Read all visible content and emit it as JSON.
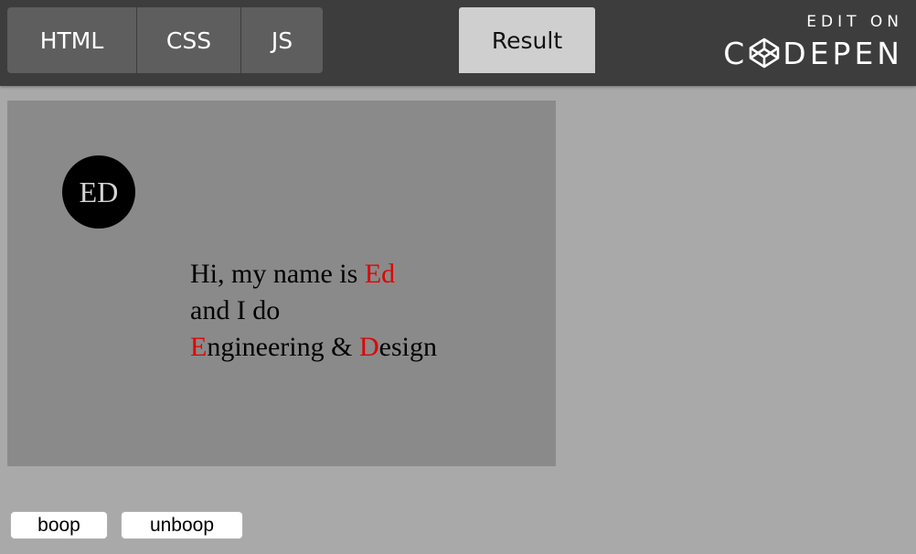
{
  "tabs": {
    "html": "HTML",
    "css": "CSS",
    "js": "JS",
    "result": "Result"
  },
  "codepen": {
    "edit_on": "EDIT ON",
    "brand_left": "C",
    "brand_right": "DEPEN",
    "icon": "codepen-logo-icon"
  },
  "card": {
    "avatar_initials": "ED",
    "line1_prefix": "Hi, my name is ",
    "line1_name": "Ed",
    "line2": "and I do",
    "line3_e": "E",
    "line3_mid": "ngineering & ",
    "line3_d": "D",
    "line3_end": "esign"
  },
  "buttons": {
    "boop": "boop",
    "unboop": "unboop"
  },
  "colors": {
    "topbar": "#3d3d3d",
    "tab": "#5e5e5e",
    "result_tab": "#cfcfcf",
    "page_bg": "#a9a9a9",
    "card_bg": "#8a8a8a",
    "accent_red": "#e00000"
  }
}
